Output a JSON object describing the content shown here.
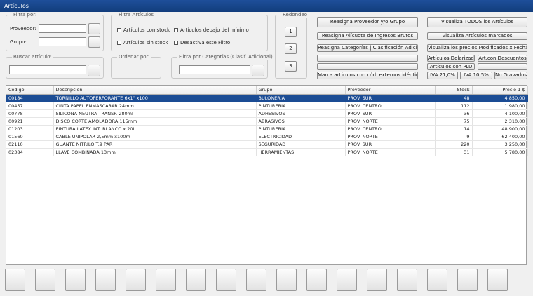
{
  "window": {
    "title": "Artículos"
  },
  "filtra_por": {
    "legend": "Filtra por:",
    "proveedor_label": "Proveedor:",
    "proveedor_value": "",
    "grupo_label": "Grupo:",
    "grupo_value": ""
  },
  "filtra_articulos": {
    "legend": "Filtra Artículos",
    "opt1": "Artículos con stock",
    "opt2": "Artículos debajo del mínimo",
    "opt3": "Artículos sin stock",
    "opt4": "Desactiva este Filtro"
  },
  "buscar": {
    "legend": "Buscar artículo:",
    "value": ""
  },
  "ordenar": {
    "legend": "Ordenar por:"
  },
  "categorias": {
    "legend": "Filtra por Categorías (Clasif. Adicional)",
    "value": ""
  },
  "redondeo": {
    "legend": "Redondeo",
    "b1": "1",
    "b2": "2",
    "b3": "3"
  },
  "actions": {
    "reasigna_proveedor": "Reasigna Proveedor y/o Grupo",
    "reasigna_alicuota": "Reasigna Alícuota de Ingresos Brutos",
    "reasigna_categorias": "Reasigna Categorías | Clasificación Adicional",
    "blank1": "",
    "blank2": "",
    "marca_externos": "Marca artículos con cód. externos idénticos",
    "visualiza_todos": "Visualiza TODOS los Artículos",
    "visualiza_marcados": "Visualiza Artículos marcados",
    "visualiza_precios": "Visualiza los precios Modificados x Fecha",
    "dolarizados": "Artículos Dolarizados",
    "descuentos": "Art.con Descuentos",
    "con_plu": "Artículos con PLU",
    "blank3": "",
    "iva21": "IVA 21,0%",
    "iva105": "IVA 10,5%",
    "no_gravados": "No Gravados"
  },
  "table": {
    "columns": [
      "Código",
      "Descripción",
      "Grupo",
      "Proveedor",
      "Stock",
      "Precio 1 $"
    ],
    "rows": [
      [
        "00184",
        "TORNILLO AUTOPERFORANTE 6x1\" x100",
        "BULONERIA",
        "PROV. SUR",
        "48",
        "4.850,00"
      ],
      [
        "00457",
        "CINTA PAPEL ENMASCARAR 24mm",
        "PINTURERIA",
        "PROV. CENTRO",
        "112",
        "1.980,00"
      ],
      [
        "00778",
        "SILICONA NEUTRA TRANSP. 280ml",
        "ADHESIVOS",
        "PROV. SUR",
        "36",
        "4.100,00"
      ],
      [
        "00921",
        "DISCO CORTE AMOLADORA 115mm",
        "ABRASIVOS",
        "PROV. NORTE",
        "75",
        "2.310,00"
      ],
      [
        "01203",
        "PINTURA LATEX INT. BLANCO x 20L",
        "PINTURERIA",
        "PROV. CENTRO",
        "14",
        "48.900,00"
      ],
      [
        "01560",
        "CABLE UNIPOLAR 2,5mm x100m",
        "ELECTRICIDAD",
        "PROV. NORTE",
        "9",
        "62.400,00"
      ],
      [
        "02110",
        "GUANTE NITRILO T.9 PAR",
        "SEGURIDAD",
        "PROV. SUR",
        "220",
        "3.250,00"
      ],
      [
        "02384",
        "LLAVE COMBINADA 13mm",
        "HERRAMIENTAS",
        "PROV. NORTE",
        "31",
        "5.780,00"
      ]
    ]
  },
  "function_buttons_count": 17
}
